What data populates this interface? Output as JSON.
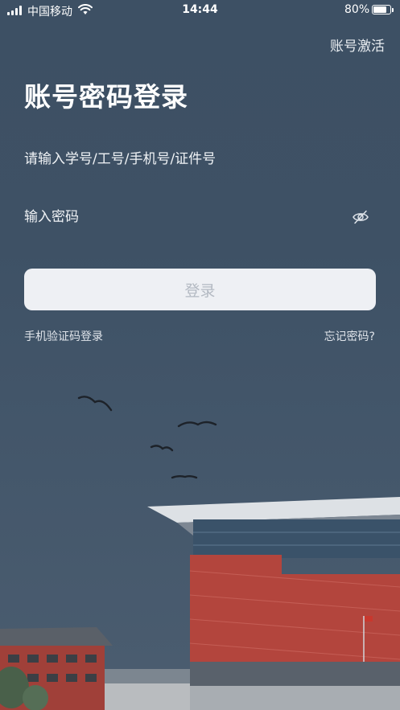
{
  "status_bar": {
    "carrier": "中国移动",
    "time": "14:44",
    "battery_percent": "80%",
    "battery_level": 0.8
  },
  "header": {
    "activate_link": "账号激活"
  },
  "login": {
    "title": "账号密码登录",
    "username_placeholder": "请输入学号/工号/手机号/证件号",
    "password_placeholder": "输入密码",
    "password_visibility_icon": "eye-off-icon",
    "login_button": "登录",
    "sms_login_link": "手机验证码登录",
    "forgot_password_link": "忘记密码?"
  },
  "colors": {
    "background": "#3e5165",
    "button_bg": "#eef0f4",
    "button_text": "#b3b9c2",
    "building_red": "#b3453d"
  }
}
